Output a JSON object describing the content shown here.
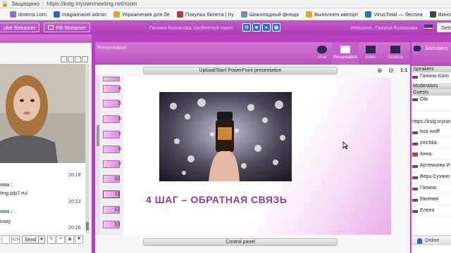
{
  "browser": {
    "security_label": "Защищено",
    "url": "https://kolg.myownmeeting.net/room",
    "bookmarks": [
      {
        "label": "doterra.com",
        "color": "#8a6fd6"
      },
      {
        "label": "magiamasel admin",
        "color": "#3b5fc0"
      },
      {
        "label": "Упражнения для бе",
        "color": "#e0a431"
      },
      {
        "label": "Покупка билета | Ку",
        "color": "#c8352b"
      },
      {
        "label": "Шоколадный фонда",
        "color": "#6f8fb8"
      },
      {
        "label": "Выполнен импорт",
        "color": "#e0a431"
      },
      {
        "label": "VirusTotal — беспла",
        "color": "#2a6fd6"
      },
      {
        "label": "Винский Сергей пут",
        "color": "#444444"
      }
    ]
  },
  "appbar": {
    "youtube_streamer": "ube Streamer",
    "fb_streamer": "FB Streamer",
    "room_title": "Галина Колосова conference room",
    "welcome": "Welcome, Галина Колосова",
    "settings": "Settin"
  },
  "center": {
    "panel_title": "Presentation",
    "tools": [
      {
        "label": "Chat",
        "icon": "chat-icon"
      },
      {
        "label": "Presentation",
        "icon": "presentation-icon"
      },
      {
        "label": "Video",
        "icon": "video-icon"
      },
      {
        "label": "Desktop",
        "icon": "desktop-icon"
      }
    ],
    "upload_bar": "Upload/Start PowerPoint presentation",
    "zoom_label": "1:1",
    "thumbnails": [
      "4",
      "5",
      "6",
      "7",
      "8",
      "9",
      "10",
      "11",
      "12",
      "13"
    ],
    "slide_text": "4 ШАГ – ОБРАТНАЯ СВЯЗЬ",
    "control_panel": "Control panel"
  },
  "chat": {
    "messages": [
      {
        "name": "ова :",
        "text": "",
        "time": "20:18"
      },
      {
        "name": "",
        "text": "ting.plp7.ru/",
        "time": "20:23"
      },
      {
        "name": "ова :",
        "text": "ышу",
        "time": "20:28"
      }
    ],
    "send_label": "Send"
  },
  "members": {
    "title": "Members",
    "sections": {
      "speakers": "Speakers",
      "moderators": "Moderators",
      "guests": "Guests"
    },
    "speaker": "Галина Коло",
    "guests": [
      {
        "name": "Ola",
        "flag": "ru"
      },
      {
        "name": "https://kolg.myow",
        "flag": "ru"
      },
      {
        "name": "lora wolff",
        "flag": "ru"
      },
      {
        "name": "znichka",
        "flag": "ru"
      },
      {
        "name": "Анна",
        "flag": "by"
      },
      {
        "name": "Артемьева И",
        "flag": "ru"
      },
      {
        "name": "Вера Сухано",
        "flag": "ru"
      },
      {
        "name": "Галина",
        "flag": "ru"
      },
      {
        "name": "Евгения",
        "flag": "ru"
      },
      {
        "name": "Елена",
        "flag": "ru"
      }
    ],
    "online_label": "Online"
  }
}
